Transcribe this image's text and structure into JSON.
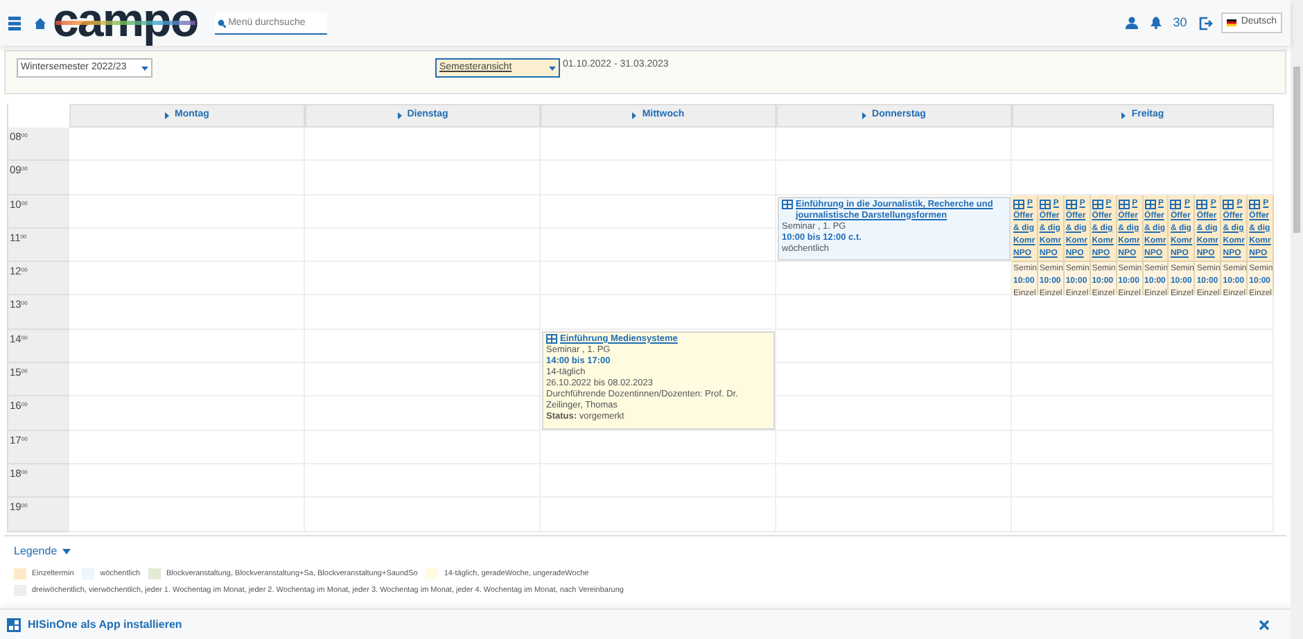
{
  "header": {
    "logo": "campo",
    "search": {
      "placeholder": "Menü durchsuche"
    },
    "notification_count": "30",
    "language": "Deutsch"
  },
  "filters": {
    "semester": "Wintersemester 2022/23",
    "view": "Semesteransicht",
    "date_range": "01.10.2022 - 31.03.2023"
  },
  "calendar": {
    "days": [
      {
        "label": "Montag"
      },
      {
        "label": "Dienstag"
      },
      {
        "label": "Mittwoch",
        "events": [
          {
            "kind": "full",
            "color": "#fffbe0",
            "title": "Einführung Mediensysteme",
            "type": "Seminar , 1. PG",
            "time": "14:00 bis 17:00",
            "rhythm": "14-täglich",
            "dates": "26.10.2022 bis 08.02.2023",
            "lecturers": "Durchführende Dozentinnen/Dozenten: Prof. Dr. Zeilinger, Thomas",
            "status": "**Status:** vorgemerkt"
          }
        ]
      },
      {
        "label": "Donnerstag",
        "events": [
          {
            "kind": "full",
            "color": "#eef6fd",
            "title": "Einführung in die Journalistik, Recherche und journalistische Darstellungsformen",
            "type": "Seminar , 1. PG",
            "time": "10:00 bis 12:00 c.t.",
            "rhythm": "wöchentlich"
          }
        ]
      },
      {
        "label": "Freitag",
        "events": [
          {
            "kind": "narrow",
            "color": "#fdebc8",
            "title_lines": [
              "P",
              "Öffer",
              "& dig",
              "Komr",
              "NPO"
            ],
            "type": "Semin",
            "time": "10:00",
            "rhythm": "Einzel"
          },
          {
            "kind": "narrow",
            "color": "#fdebc8",
            "title_lines": [
              "P",
              "Öffer",
              "& dig",
              "Komr",
              "NPO"
            ],
            "type": "Semin",
            "time": "10:00",
            "rhythm": "Einzel"
          },
          {
            "kind": "narrow",
            "color": "#fdebc8",
            "title_lines": [
              "P",
              "Öffer",
              "& dig",
              "Komr",
              "NPO"
            ],
            "type": "Semin",
            "time": "10:00",
            "rhythm": "Einzel"
          },
          {
            "kind": "narrow",
            "color": "#fdebc8",
            "title_lines": [
              "P",
              "Öffer",
              "& dig",
              "Komr",
              "NPO"
            ],
            "type": "Semin",
            "time": "10:00",
            "rhythm": "Einzel"
          },
          {
            "kind": "narrow",
            "color": "#fdebc8",
            "title_lines": [
              "P",
              "Öffer",
              "& dig",
              "Komr",
              "NPO"
            ],
            "type": "Semin",
            "time": "10:00",
            "rhythm": "Einzel"
          },
          {
            "kind": "narrow",
            "color": "#fdebc8",
            "title_lines": [
              "P",
              "Öffer",
              "& dig",
              "Komr",
              "NPO"
            ],
            "type": "Semin",
            "time": "10:00",
            "rhythm": "Einzel"
          },
          {
            "kind": "narrow",
            "color": "#fdebc8",
            "title_lines": [
              "P",
              "Öffer",
              "& dig",
              "Komr",
              "NPO"
            ],
            "type": "Semin",
            "time": "10:00",
            "rhythm": "Einzel"
          },
          {
            "kind": "narrow",
            "color": "#fdebc8",
            "title_lines": [
              "P",
              "Öffer",
              "& dig",
              "Komr",
              "NPO"
            ],
            "type": "Semin",
            "time": "10:00",
            "rhythm": "Einzel"
          },
          {
            "kind": "narrow",
            "color": "#fdebc8",
            "title_lines": [
              "P",
              "Öffer",
              "& dig",
              "Komr",
              "NPO"
            ],
            "type": "Semin",
            "time": "10:00",
            "rhythm": "Einzel"
          },
          {
            "kind": "narrow",
            "color": "#fdebc8",
            "title_lines": [
              "P",
              "Öffer",
              "& dig",
              "Komr",
              "NPO"
            ],
            "type": "Semin",
            "time": "10:00",
            "rhythm": "Einzel"
          }
        ]
      }
    ],
    "hours": [
      "08$^{00}$",
      "09$^{00}$",
      "10$^{00}$",
      "11$^{00}$",
      "12$^{00}$",
      "13$^{00}$",
      "14$^{00}$",
      "15$^{00}$",
      "16$^{00}$",
      "17$^{00}$",
      "18$^{00}$",
      "19$^{00}$"
    ]
  },
  "legend": {
    "title": "Legende",
    "items": [
      {
        "label": "Einzeltermin",
        "color": "#fdebc8"
      },
      {
        "label": "wöchentlich",
        "color": "#eef6fd"
      },
      {
        "label": "Blockveranstaltung, Blockveranstaltung+Sa, Blockveranstaltung+SaundSo",
        "color": "#e2ecd5"
      },
      {
        "label": "14-täglich, geradeWoche, ungeradeWoche",
        "color": "#fffbe0"
      },
      {
        "label": "dreiwöchentlich, vierwöchentlich, jeder 1. Wochentag im Monat, jeder 2. Wochentag im Monat, jeder 3. Wochentag im Monat, jeder 4. Wochentag im Monat, nach Vereinbarung",
        "color": "#eeeeee"
      }
    ]
  },
  "install_bar": {
    "text": "HISinOne als App installieren"
  }
}
